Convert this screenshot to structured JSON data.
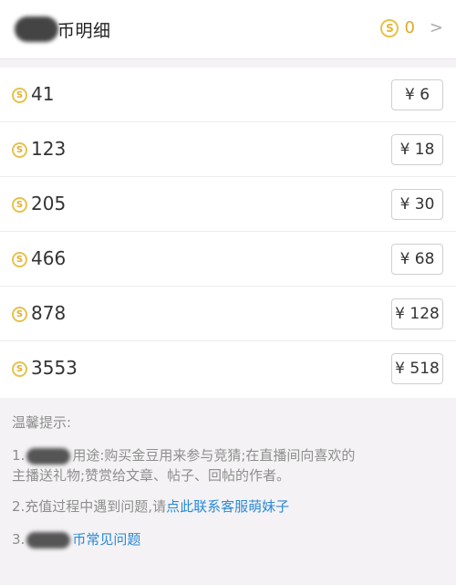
{
  "header": {
    "title": "币明细",
    "balance": "0",
    "chevron": ">"
  },
  "packages": [
    {
      "coins": "41",
      "price": "¥ 6"
    },
    {
      "coins": "123",
      "price": "¥ 18"
    },
    {
      "coins": "205",
      "price": "¥ 30"
    },
    {
      "coins": "466",
      "price": "¥ 68"
    },
    {
      "coins": "878",
      "price": "¥ 128"
    },
    {
      "coins": "3553",
      "price": "¥ 518"
    }
  ],
  "tips": {
    "title": "温馨提示:",
    "tip1_prefix": "1.",
    "tip1_text": "用途:购买金豆用来参与竞猜;在直播间向喜欢的",
    "tip1_text2": "主播送礼物;赞赏给文章、帖子、回帖的作者。",
    "tip2_text": "2.充值过程中遇到问题,请",
    "tip2_link": "点此联系客服萌妹子",
    "tip3_prefix": "3.",
    "tip3_link": "币常见问题"
  },
  "icons": {
    "coin": "coin-icon",
    "chevron": "chevron-right-icon"
  },
  "colors": {
    "coin": "#e2ae2e",
    "link": "#2a8ad6",
    "tip_text": "#8e8e8e"
  }
}
